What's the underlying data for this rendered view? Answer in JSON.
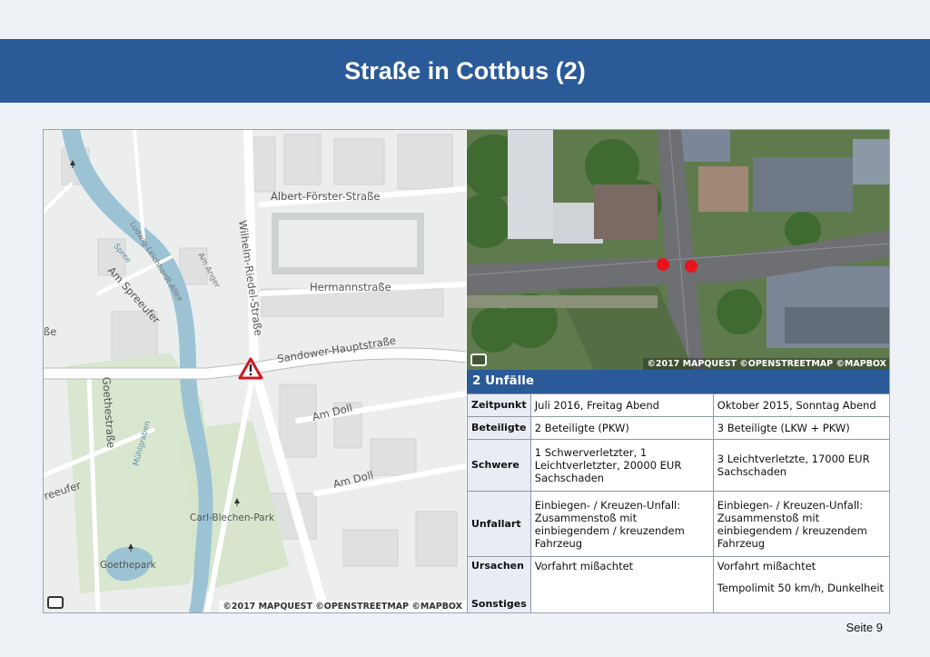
{
  "title": "Straße in Cottbus (2)",
  "page_number": "Seite 9",
  "map": {
    "copyright": "©2017 MAPQUEST ©OPENSTREETMAP ©MAPBOX",
    "streets": {
      "albert": "Albert-Förster-Straße",
      "wilhelm": "Wilhelm-Riedel-Straße",
      "hermann": "Hermannstraße",
      "sandower": "Sandower-Hauptstraße",
      "amdoll1": "Am Doll",
      "amdoll2": "Am Doll",
      "amspreeufer": "Am Spreeufer",
      "goethe": "Goethestraße",
      "ludwig": "Ludwig-Leichhardt-Allee",
      "amanger": "Am Anger",
      "spree": "Spree",
      "muehlgraben": "Mühlgraben",
      "carlblechen": "Carl-Blechen-Park",
      "goethepark": "Goethepark",
      "reeufer": "reeufer",
      "sse": "ße"
    }
  },
  "satellite": {
    "copyright": "©2017 MAPQUEST ©OPENSTREETMAP ©MAPBOX",
    "accident_color": "#e8141c"
  },
  "accidents": {
    "header": "2 Unfälle",
    "rows": [
      {
        "label": "Zeitpunkt",
        "a": "Juli 2016, Freitag Abend",
        "b": "Oktober 2015, Sonntag Abend"
      },
      {
        "label": "Beteiligte",
        "a": "2 Beteiligte (PKW)",
        "b": "3 Beteiligte (LKW + PKW)"
      },
      {
        "label": "Schwere",
        "a": "1 Schwerverletzter, 1 Leichtverletzter, 20000 EUR Sachschaden",
        "b": "3 Leichtverletzte, 17000 EUR Sachschaden"
      },
      {
        "label": "Unfallart",
        "a": "Einbiegen- / Kreuzen-Unfall: Zusammenstoß mit einbiegendem / kreuzendem Fahrzeug",
        "b": "Einbiegen- / Kreuzen-Unfall: Zusammenstoß mit einbiegendem / kreuzendem Fahrzeug"
      }
    ],
    "ursachen": {
      "label": "Ursachen",
      "a": "Vorfahrt mißachtet",
      "b": "Vorfahrt mißachtet"
    },
    "sonstiges": {
      "label": "Sonstiges",
      "a": "",
      "b": "Tempolimit 50 km/h, Dunkelheit"
    }
  }
}
